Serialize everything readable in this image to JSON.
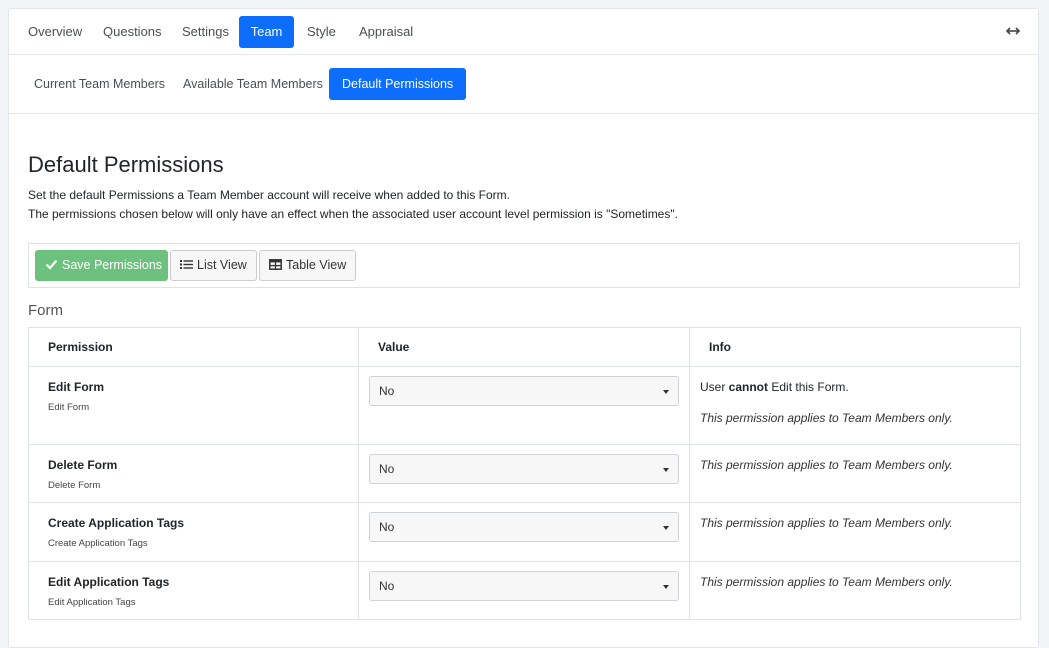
{
  "main_tabs": [
    {
      "label": "Overview"
    },
    {
      "label": "Questions"
    },
    {
      "label": "Settings"
    },
    {
      "label": "Team",
      "active": true
    },
    {
      "label": "Style"
    },
    {
      "label": "Appraisal"
    }
  ],
  "sub_tabs": [
    {
      "label": "Current Team Members"
    },
    {
      "label": "Available Team Members"
    },
    {
      "label": "Default Permissions",
      "active": true
    }
  ],
  "page": {
    "title": "Default Permissions",
    "description_1": "Set the default Permissions a Team Member account will receive when added to this Form.",
    "description_2": "The permissions chosen below will only have an effect when the associated user account level permission is \"Sometimes\"."
  },
  "toolbar": {
    "save_label": "Save Permissions",
    "list_view_label": "List View",
    "table_view_label": "Table View"
  },
  "section": {
    "title": "Form"
  },
  "table": {
    "headers": [
      "Permission",
      "Value",
      "Info"
    ],
    "rows": [
      {
        "title": "Edit Form",
        "subtitle": "Edit Form",
        "value": "No",
        "info_prefix": "User ",
        "info_bold": "cannot",
        "info_suffix": " Edit this Form.",
        "note": "This permission applies to Team Members only."
      },
      {
        "title": "Delete Form",
        "subtitle": "Delete Form",
        "value": "No",
        "note": "This permission applies to Team Members only."
      },
      {
        "title": "Create Application Tags",
        "subtitle": "Create Application Tags",
        "value": "No",
        "note": "This permission applies to Team Members only."
      },
      {
        "title": "Edit Application Tags",
        "subtitle": "Edit Application Tags",
        "value": "No",
        "note": "This permission applies to Team Members only."
      }
    ]
  },
  "colors": {
    "primary": "#0d6efd",
    "success": "#6dc17f"
  },
  "icons": {
    "expand": "arrows-horizontal-icon",
    "save": "check-icon",
    "list": "list-icon",
    "table": "table-icon"
  }
}
